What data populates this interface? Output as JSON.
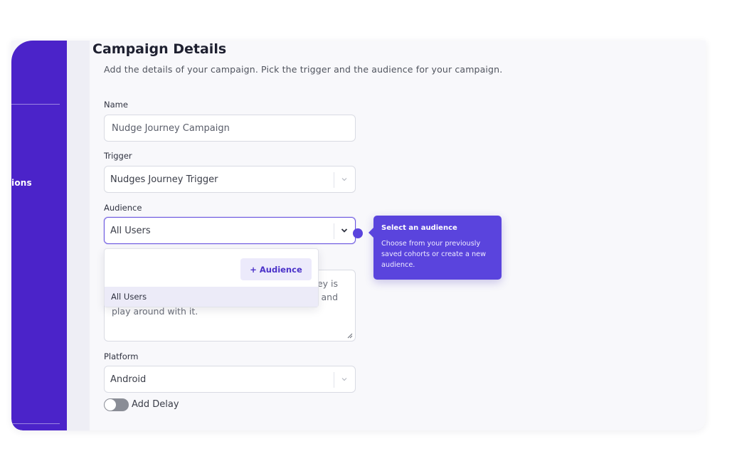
{
  "sidebar": {
    "partial_nav_label": "ions"
  },
  "page": {
    "title": "Campaign Details",
    "subtitle": "Add the details of your campaign. Pick the trigger and the audience for your campaign."
  },
  "form": {
    "name": {
      "label": "Name",
      "placeholder": "Nudge Journey Campaign"
    },
    "trigger": {
      "label": "Trigger",
      "value": "Nudges Journey Trigger"
    },
    "audience": {
      "label": "Audience",
      "value": "All Users",
      "add_button": "+ Audience",
      "options": [
        "All Users"
      ]
    },
    "description": {
      "visible_fragments": [
        "ey is",
        ": and",
        "play around with it."
      ]
    },
    "platform": {
      "label": "Platform",
      "value": "Android"
    },
    "delay": {
      "label": "Add Delay",
      "enabled": false
    }
  },
  "tooltip": {
    "title": "Select an audience",
    "body": "Choose from your previously saved cohorts or create a new audience."
  },
  "colors": {
    "brand": "#4b23c9",
    "accent": "#5a44dd",
    "option_highlight": "#ecebf8"
  },
  "icons": {
    "select_chevron": "chevron-down-icon",
    "resize_handle": "resize-handle-icon",
    "tooltip_anchor": "dot-indicator-icon"
  }
}
